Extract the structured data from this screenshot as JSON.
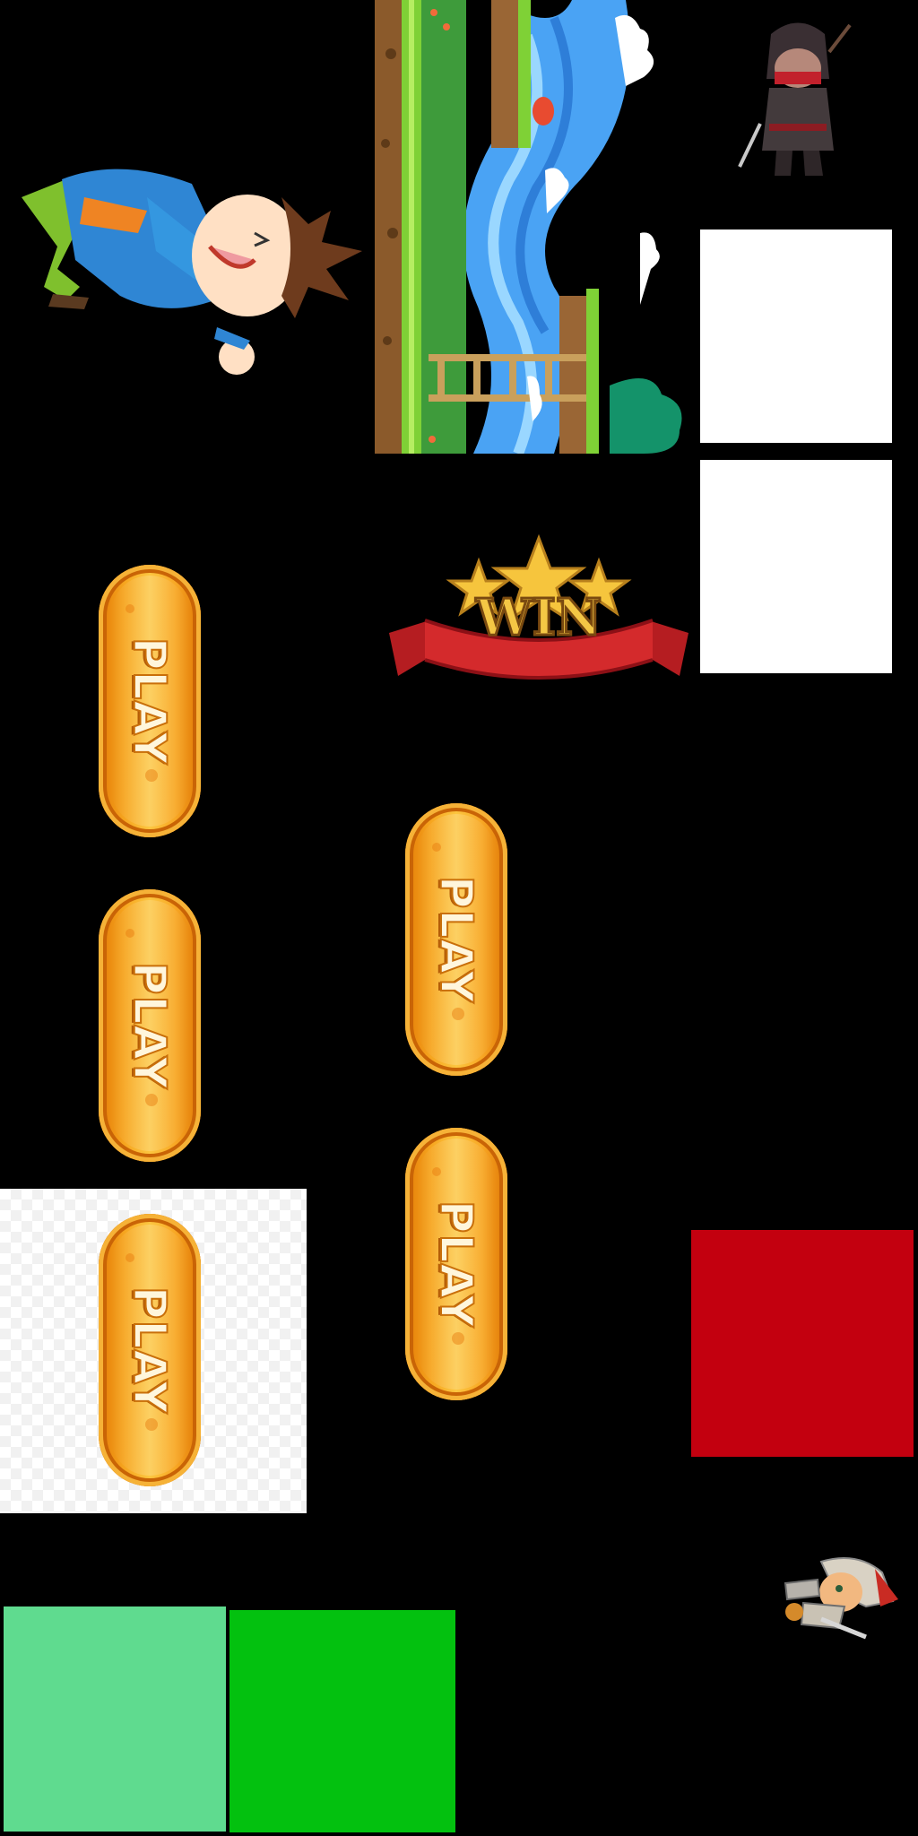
{
  "buttons": {
    "play_1": "PLAY",
    "play_2": "PLAY",
    "play_3": "PLAY",
    "play_4": "PLAY",
    "play_5": "PLAY"
  },
  "banner": {
    "win_text": "WIN"
  },
  "colors": {
    "background": "#000000",
    "button_orange": "#f6a51f",
    "red_block": "#c3000f",
    "mint_block": "#5fdb8f",
    "green_block": "#03c10f",
    "white_panel": "#ffffff"
  },
  "icons": [
    "sleeping-boy-sprite",
    "level-map-sprite",
    "ninja-sprite",
    "win-banner-icon",
    "knight-sprite"
  ]
}
